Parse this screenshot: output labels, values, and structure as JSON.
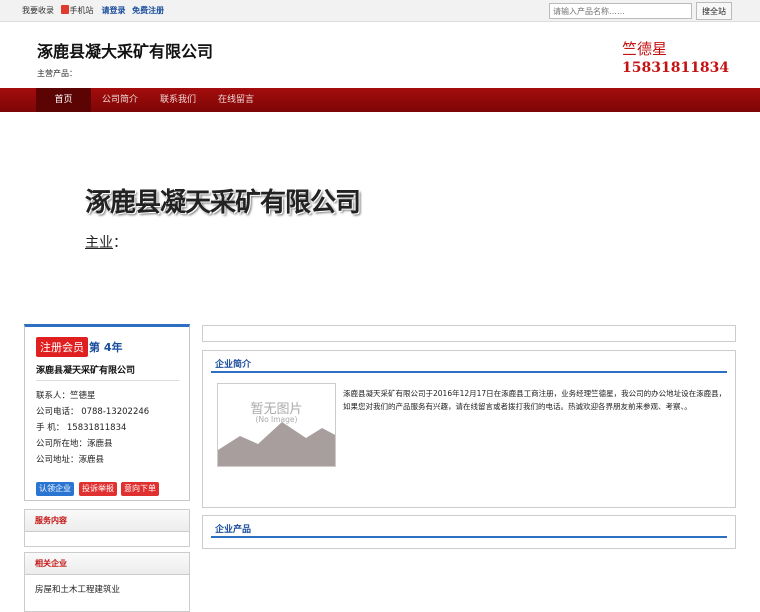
{
  "topbar": {
    "collect": "我要收录",
    "mobile": "手机站",
    "login": "请登录",
    "register": "免费注册",
    "search_placeholder": "请输入产品名称……",
    "search_button": "搜全站"
  },
  "header": {
    "company_name": "涿鹿县凝大采矿有限公司",
    "main_products": "主营产品：",
    "contact_name": "竺德星",
    "contact_phone": "15831811834"
  },
  "nav": {
    "items": [
      "首页",
      "公司简介",
      "联系我们",
      "在线留言"
    ]
  },
  "banner": {
    "title": "涿鹿县凝天采矿有限公司",
    "sub_label": "主业",
    "sub_colon": "："
  },
  "card": {
    "badge": "注册会员",
    "year": "第 4年",
    "company": "涿鹿县凝天采矿有限公司",
    "contact": "联系人：竺德星",
    "tel": "公司电话： 0788-13202246",
    "mobile": "手 机： 15831811834",
    "location": "公司所在地：涿鹿县",
    "address": "公司地址：涿鹿县",
    "buttons": [
      "认领企业",
      "投诉举报",
      "意向下单"
    ]
  },
  "services": {
    "title": "服务内容"
  },
  "related": {
    "title": "相关企业",
    "items": [
      "房屋和土木工程建筑业"
    ]
  },
  "intro": {
    "title": "企业简介",
    "noimg_text": "暂无图片",
    "noimg_sub": "(No Image)",
    "text": "涿鹿县凝天采矿有限公司于2016年12月17日在涿鹿县工商注册，业务经理竺德星，我公司的办公地址设在涿鹿县，如果您对我们的产品服务有兴趣，请在线留言或者拨打我们的电话。热诚欢迎各界朋友前来参观、考察、。"
  },
  "products": {
    "title": "企业产品"
  },
  "colors": {
    "nav_red": "#8f0909",
    "accent_blue": "#2d6fc1",
    "contact_red": "#c41313"
  }
}
